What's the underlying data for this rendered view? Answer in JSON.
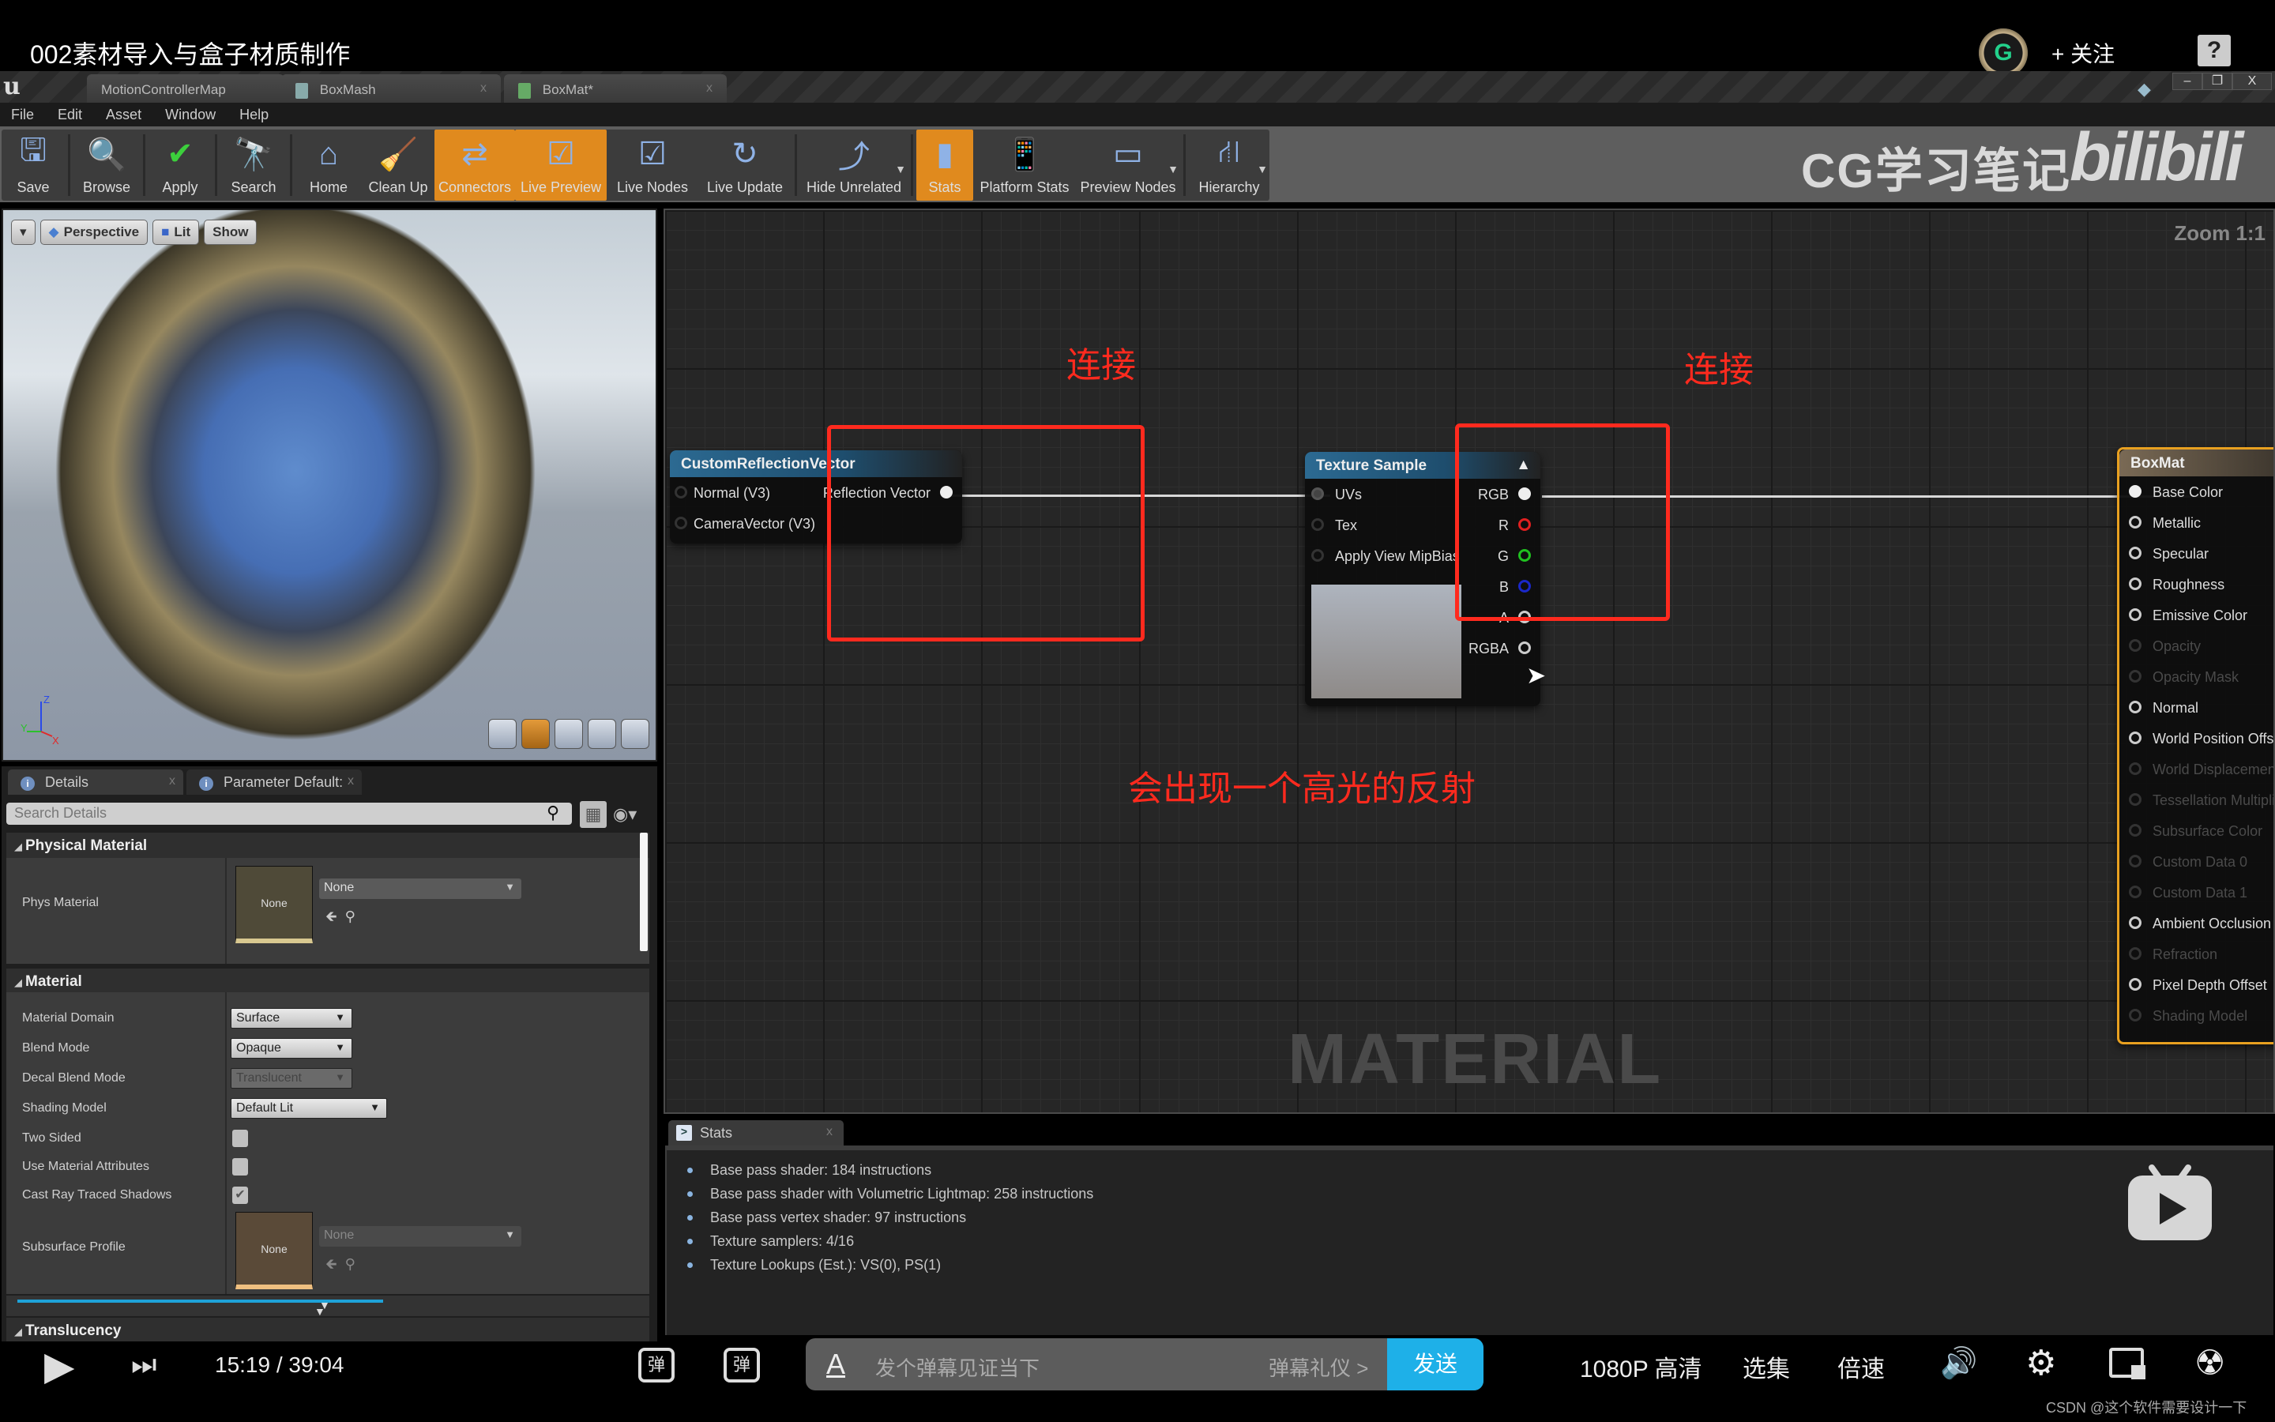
{
  "video": {
    "title": "002素材导入与盒子材质制作",
    "follow_label": "+ 关注",
    "avatar_letter": "G",
    "help": "?"
  },
  "ue": {
    "tabs": [
      {
        "label": "MotionControllerMap",
        "closable": false
      },
      {
        "label": "BoxMash",
        "closable": true,
        "close": "x"
      },
      {
        "label": "BoxMat*",
        "closable": true,
        "close": "x"
      }
    ],
    "window_controls": [
      "–",
      "❐",
      "X"
    ],
    "menu": [
      "File",
      "Edit",
      "Asset",
      "Window",
      "Help"
    ],
    "toolbar": [
      {
        "label": "Save",
        "icon": "save-icon",
        "glyph": "🖫",
        "active": false
      },
      {
        "label": "Browse",
        "icon": "browse-icon",
        "glyph": "🔍",
        "active": false
      },
      {
        "label": "Apply",
        "icon": "apply-icon",
        "glyph": "✔",
        "active": false
      },
      {
        "label": "Search",
        "icon": "search-icon",
        "glyph": "🔭",
        "active": false
      },
      {
        "label": "Home",
        "icon": "home-icon",
        "glyph": "⌂",
        "active": false
      },
      {
        "label": "Clean Up",
        "icon": "clean-up-icon",
        "glyph": "🧹",
        "active": false
      },
      {
        "label": "Connectors",
        "icon": "connectors-icon",
        "glyph": "⇄",
        "active": true
      },
      {
        "label": "Live Preview",
        "icon": "live-preview-icon",
        "glyph": "☑",
        "active": true
      },
      {
        "label": "Live Nodes",
        "icon": "live-nodes-icon",
        "glyph": "☑",
        "active": false
      },
      {
        "label": "Live Update",
        "icon": "live-update-icon",
        "glyph": "↻",
        "active": false
      },
      {
        "label": "Hide Unrelated",
        "icon": "hide-unrelated-icon",
        "glyph": "⤴",
        "active": false,
        "dropdown": true
      },
      {
        "label": "Stats",
        "icon": "stats-icon",
        "glyph": "▮",
        "active": true
      },
      {
        "label": "Platform Stats",
        "icon": "platform-stats-icon",
        "glyph": "📱",
        "active": false
      },
      {
        "label": "Preview Nodes",
        "icon": "preview-nodes-icon",
        "glyph": "▭",
        "active": false,
        "dropdown": true
      },
      {
        "label": "Hierarchy",
        "icon": "hierarchy-icon",
        "glyph": "⛙",
        "active": false,
        "dropdown": true
      }
    ],
    "watermark": "CG学习笔记",
    "bili_logo": "bilibili"
  },
  "viewport": {
    "menu_arrow": "▾",
    "perspective": "Perspective",
    "lit": "Lit",
    "show": "Show",
    "axis": {
      "x": "X",
      "y": "Y",
      "z": "Z"
    }
  },
  "details": {
    "tabs": [
      {
        "label": "Details",
        "close": "x"
      },
      {
        "label": "Parameter Default:",
        "close": "x"
      }
    ],
    "search_placeholder": "Search Details",
    "sections": {
      "physical_material": "Physical Material",
      "material": "Material",
      "translucency": "Translucency"
    },
    "phys_material": {
      "label": "Phys Material",
      "thumb": "None",
      "value": "None"
    },
    "material_props": [
      {
        "label": "Material Domain",
        "type": "combo",
        "value": "Surface"
      },
      {
        "label": "Blend Mode",
        "type": "combo",
        "value": "Opaque"
      },
      {
        "label": "Decal Blend Mode",
        "type": "combo",
        "value": "Translucent",
        "disabled": true
      },
      {
        "label": "Shading Model",
        "type": "combo",
        "value": "Default Lit"
      },
      {
        "label": "Two Sided",
        "type": "check",
        "checked": false
      },
      {
        "label": "Use Material Attributes",
        "type": "check",
        "checked": false
      },
      {
        "label": "Cast Ray Traced Shadows",
        "type": "check",
        "checked": true
      }
    ],
    "subsurface": {
      "label": "Subsurface Profile",
      "thumb": "None",
      "value": "None"
    }
  },
  "graph": {
    "zoom": "Zoom 1:1",
    "watermark": "MATERIAL",
    "annotations": {
      "connect_left": "连接",
      "connect_right": "连接",
      "note": "会出现一个高光的反射"
    },
    "custom_reflection": {
      "title": "CustomReflectionVector",
      "inputs": [
        "Normal (V3)",
        "CameraVector (V3)"
      ],
      "output": "Reflection Vector"
    },
    "texture_sample": {
      "title": "Texture Sample",
      "collapse": "▲",
      "inputs": [
        "UVs",
        "Tex",
        "Apply View MipBias"
      ],
      "outputs": [
        {
          "label": "RGB",
          "color": "#eeeeee",
          "connected": true
        },
        {
          "label": "R",
          "color": "#e02020"
        },
        {
          "label": "G",
          "color": "#20c020"
        },
        {
          "label": "B",
          "color": "#1a28c8"
        },
        {
          "label": "A",
          "color": "#cccccc"
        },
        {
          "label": "RGBA",
          "color": "#cccccc"
        }
      ]
    },
    "boxmat": {
      "title": "BoxMat",
      "pins": [
        {
          "label": "Base Color",
          "enabled": true,
          "connected": true
        },
        {
          "label": "Metallic",
          "enabled": true
        },
        {
          "label": "Specular",
          "enabled": true
        },
        {
          "label": "Roughness",
          "enabled": true
        },
        {
          "label": "Emissive Color",
          "enabled": true
        },
        {
          "label": "Opacity",
          "enabled": false
        },
        {
          "label": "Opacity Mask",
          "enabled": false
        },
        {
          "label": "Normal",
          "enabled": true
        },
        {
          "label": "World Position Offset",
          "enabled": true
        },
        {
          "label": "World Displacement",
          "enabled": false
        },
        {
          "label": "Tessellation Multiplier",
          "enabled": false
        },
        {
          "label": "Subsurface Color",
          "enabled": false
        },
        {
          "label": "Custom Data 0",
          "enabled": false
        },
        {
          "label": "Custom Data 1",
          "enabled": false
        },
        {
          "label": "Ambient Occlusion",
          "enabled": true
        },
        {
          "label": "Refraction",
          "enabled": false
        },
        {
          "label": "Pixel Depth Offset",
          "enabled": true
        },
        {
          "label": "Shading Model",
          "enabled": false
        }
      ]
    }
  },
  "stats": {
    "tab": "Stats",
    "close": "x",
    "lines": [
      "Base pass shader: 184 instructions",
      "Base pass shader with Volumetric Lightmap: 258 instructions",
      "Base pass vertex shader: 97 instructions",
      "Texture samplers: 4/16",
      "Texture Lookups (Est.): VS(0), PS(1)"
    ]
  },
  "player": {
    "current_time": "15:19",
    "separator": "/",
    "duration": "39:04",
    "progress": 0.392,
    "danmaku_placeholder": "发个弹幕见证当下",
    "danmaku_etiquette": "弹幕礼仪 >",
    "send": "发送",
    "quality": "1080P 高清",
    "episodes": "选集",
    "speed": "倍速",
    "danmaku_off_icon": "弹",
    "danmaku_settings_icon": "弹"
  },
  "credit": "CSDN @这个软件需要设计一下"
}
